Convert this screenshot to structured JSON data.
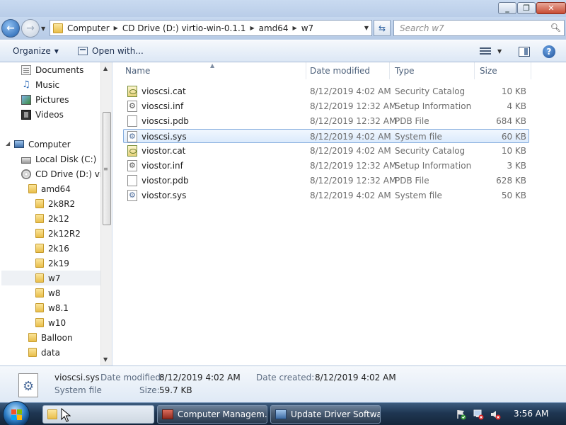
{
  "window": {
    "minimize_glyph": "_",
    "maximize_glyph": "❐",
    "close_glyph": "✕"
  },
  "address_bar": {
    "breadcrumbs": [
      "Computer",
      "CD Drive (D:) virtio-win-0.1.1",
      "amd64",
      "w7"
    ]
  },
  "search": {
    "placeholder": "Search w7"
  },
  "commands": {
    "organize": "Organize",
    "open_with": "Open with..."
  },
  "nav_pane": {
    "items": [
      {
        "label": "Documents",
        "icon": "documents-icon"
      },
      {
        "label": "Music",
        "icon": "music-icon"
      },
      {
        "label": "Pictures",
        "icon": "pictures-icon"
      },
      {
        "label": "Videos",
        "icon": "videos-icon"
      },
      {
        "label": "Computer",
        "icon": "computer-icon"
      },
      {
        "label": "Local Disk (C:)",
        "icon": "drive-icon"
      },
      {
        "label": "CD Drive (D:) virti",
        "icon": "cd-drive-icon"
      },
      {
        "label": "amd64",
        "icon": "folder-icon"
      },
      {
        "label": "2k8R2",
        "icon": "folder-icon"
      },
      {
        "label": "2k12",
        "icon": "folder-icon"
      },
      {
        "label": "2k12R2",
        "icon": "folder-icon"
      },
      {
        "label": "2k16",
        "icon": "folder-icon"
      },
      {
        "label": "2k19",
        "icon": "folder-icon"
      },
      {
        "label": "w7",
        "icon": "folder-icon"
      },
      {
        "label": "w8",
        "icon": "folder-icon"
      },
      {
        "label": "w8.1",
        "icon": "folder-icon"
      },
      {
        "label": "w10",
        "icon": "folder-icon"
      },
      {
        "label": "Balloon",
        "icon": "folder-icon"
      },
      {
        "label": "data",
        "icon": "folder-icon"
      }
    ],
    "selected": "w7"
  },
  "file_list": {
    "columns": [
      "Name",
      "Date modified",
      "Type",
      "Size"
    ],
    "rows": [
      {
        "name": "vioscsi.cat",
        "date": "8/12/2019 4:02 AM",
        "type": "Security Catalog",
        "size": "10 KB",
        "icon": "catalog-file-icon"
      },
      {
        "name": "vioscsi.inf",
        "date": "8/12/2019 12:32 AM",
        "type": "Setup Information",
        "size": "4 KB",
        "icon": "setup-info-file-icon"
      },
      {
        "name": "vioscsi.pdb",
        "date": "8/12/2019 12:32 AM",
        "type": "PDB File",
        "size": "684 KB",
        "icon": "generic-file-icon"
      },
      {
        "name": "vioscsi.sys",
        "date": "8/12/2019 4:02 AM",
        "type": "System file",
        "size": "60 KB",
        "icon": "system-file-icon"
      },
      {
        "name": "viostor.cat",
        "date": "8/12/2019 4:02 AM",
        "type": "Security Catalog",
        "size": "10 KB",
        "icon": "catalog-file-icon"
      },
      {
        "name": "viostor.inf",
        "date": "8/12/2019 12:32 AM",
        "type": "Setup Information",
        "size": "3 KB",
        "icon": "setup-info-file-icon"
      },
      {
        "name": "viostor.pdb",
        "date": "8/12/2019 12:32 AM",
        "type": "PDB File",
        "size": "628 KB",
        "icon": "generic-file-icon"
      },
      {
        "name": "viostor.sys",
        "date": "8/12/2019 4:02 AM",
        "type": "System file",
        "size": "50 KB",
        "icon": "system-file-icon"
      }
    ],
    "selected": "vioscsi.sys"
  },
  "details": {
    "filename": "vioscsi.sys",
    "file_type": "System file",
    "date_modified_label": "Date modified:",
    "date_modified": "8/12/2019 4:02 AM",
    "date_created_label": "Date created:",
    "date_created": "8/12/2019 4:02 AM",
    "size_label": "Size:",
    "size": "59.7 KB"
  },
  "taskbar": {
    "buttons": [
      {
        "label": "",
        "icon": "explorer-folder-icon",
        "active": true
      },
      {
        "label": "Computer Managem...",
        "icon": "computer-management-icon",
        "active": false
      },
      {
        "label": "Update Driver Softwa...",
        "icon": "update-driver-icon",
        "active": false
      }
    ],
    "clock": "3:56 AM"
  },
  "colors": {
    "selection_border": "#84acdd",
    "taskbar_bg": "#1f3652",
    "chrome_bg": "#c6d8ef"
  }
}
